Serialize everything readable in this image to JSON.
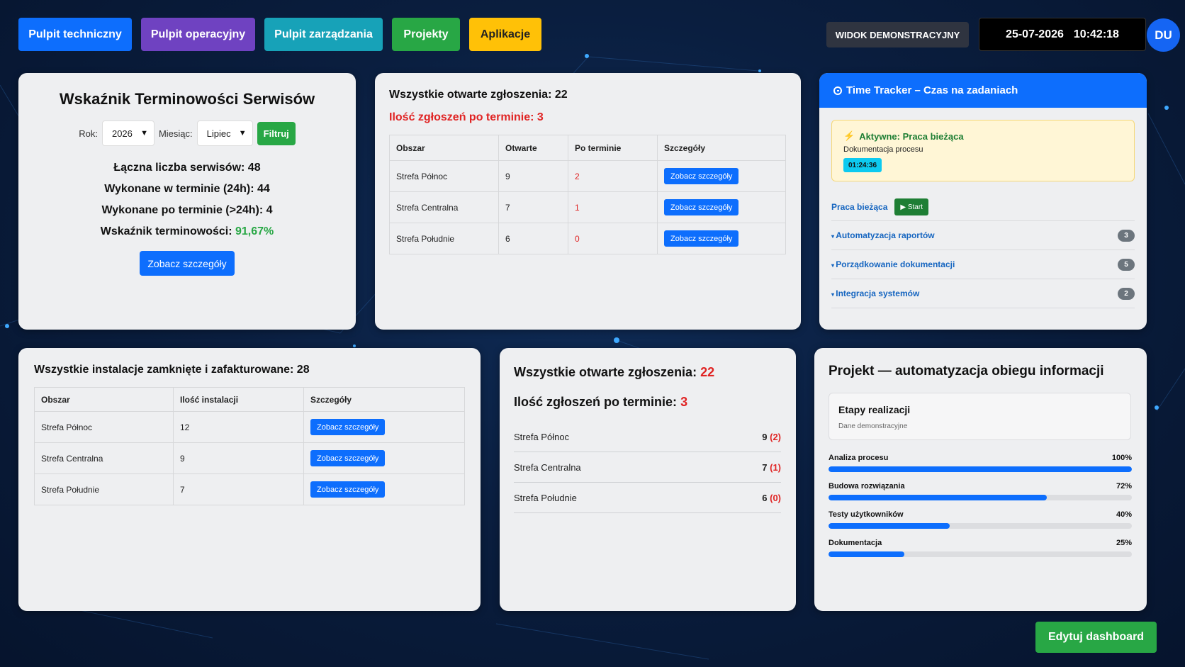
{
  "nav": {
    "items": [
      {
        "label": "Pulpit techniczny",
        "color": "#0d6efd"
      },
      {
        "label": "Pulpit operacyjny",
        "color": "#6f42c1"
      },
      {
        "label": "Pulpit zarządzania",
        "color": "#17a2b8"
      },
      {
        "label": "Projekty",
        "color": "#28a745"
      },
      {
        "label": "Aplikacje",
        "color": "#ffc107"
      }
    ],
    "demo_badge": "WIDOK DEMONSTRACYJNY",
    "date": "25-07-2026",
    "time": "10:42:18",
    "avatar": "DU"
  },
  "timeliness": {
    "title": "Wskaźnik Terminowości Serwisów",
    "year_label": "Rok:",
    "year_value": "2026",
    "month_label": "Miesiąc:",
    "month_value": "Lipiec",
    "filter_button": "Filtruj",
    "total": "Łączna liczba serwisów: 48",
    "on_time": "Wykonane w terminie (24h): 44",
    "late": "Wykonane po terminie (>24h): 4",
    "ratio_label": "Wskaźnik terminowości:",
    "ratio_value": "91,67%",
    "details_button": "Zobacz szczegóły"
  },
  "open_tickets": {
    "title": "Wszystkie otwarte zgłoszenia: 22",
    "overdue": "Ilość zgłoszeń po terminie: 3",
    "headers": [
      "Obszar",
      "Otwarte",
      "Po terminie",
      "Szczegóły"
    ],
    "rows": [
      {
        "area": "Strefa Północ",
        "open": "9",
        "overdue": "2",
        "button": "Zobacz szczegóły"
      },
      {
        "area": "Strefa Centralna",
        "open": "7",
        "overdue": "1",
        "button": "Zobacz szczegóły"
      },
      {
        "area": "Strefa Południe",
        "open": "6",
        "overdue": "0",
        "button": "Zobacz szczegóły"
      }
    ]
  },
  "time_tracker": {
    "title": "Time Tracker – Czas na zadaniach",
    "active_label": "Aktywne: Praca bieżąca",
    "active_sub": "Dokumentacja procesu",
    "active_timer": "01:24:36",
    "current_link": "Praca bieżąca",
    "start_button": "▶ Start",
    "tasks": [
      {
        "name": "Automatyzacja raportów",
        "count": "3"
      },
      {
        "name": "Porządkowanie dokumentacji",
        "count": "5"
      },
      {
        "name": "Integracja systemów",
        "count": "2"
      }
    ]
  },
  "installations": {
    "title": "Wszystkie instalacje zamknięte i zafakturowane: 28",
    "headers": [
      "Obszar",
      "Ilość instalacji",
      "Szczegóły"
    ],
    "rows": [
      {
        "area": "Strefa Północ",
        "count": "12",
        "button": "Zobacz szczegóły"
      },
      {
        "area": "Strefa Centralna",
        "count": "9",
        "button": "Zobacz szczegóły"
      },
      {
        "area": "Strefa Południe",
        "count": "7",
        "button": "Zobacz szczegóły"
      }
    ]
  },
  "open_summary": {
    "title_label": "Wszystkie otwarte zgłoszenia:",
    "title_value": "22",
    "overdue_label": "Ilość zgłoszeń po terminie:",
    "overdue_value": "3",
    "rows": [
      {
        "area": "Strefa Północ",
        "open": "9",
        "overdue": "(2)"
      },
      {
        "area": "Strefa Centralna",
        "open": "7",
        "overdue": "(1)"
      },
      {
        "area": "Strefa Południe",
        "open": "6",
        "overdue": "(0)"
      }
    ]
  },
  "project": {
    "title": "Projekt — automatyzacja obiegu informacji",
    "stages_title": "Etapy realizacji",
    "stages_sub": "Dane demonstracyjne",
    "stages": [
      {
        "name": "Analiza procesu",
        "percent_label": "100%",
        "percent": 100
      },
      {
        "name": "Budowa rozwiązania",
        "percent_label": "72%",
        "percent": 72
      },
      {
        "name": "Testy użytkowników",
        "percent_label": "40%",
        "percent": 40
      },
      {
        "name": "Dokumentacja",
        "percent_label": "25%",
        "percent": 25
      }
    ]
  },
  "edit_button": "Edytuj dashboard"
}
